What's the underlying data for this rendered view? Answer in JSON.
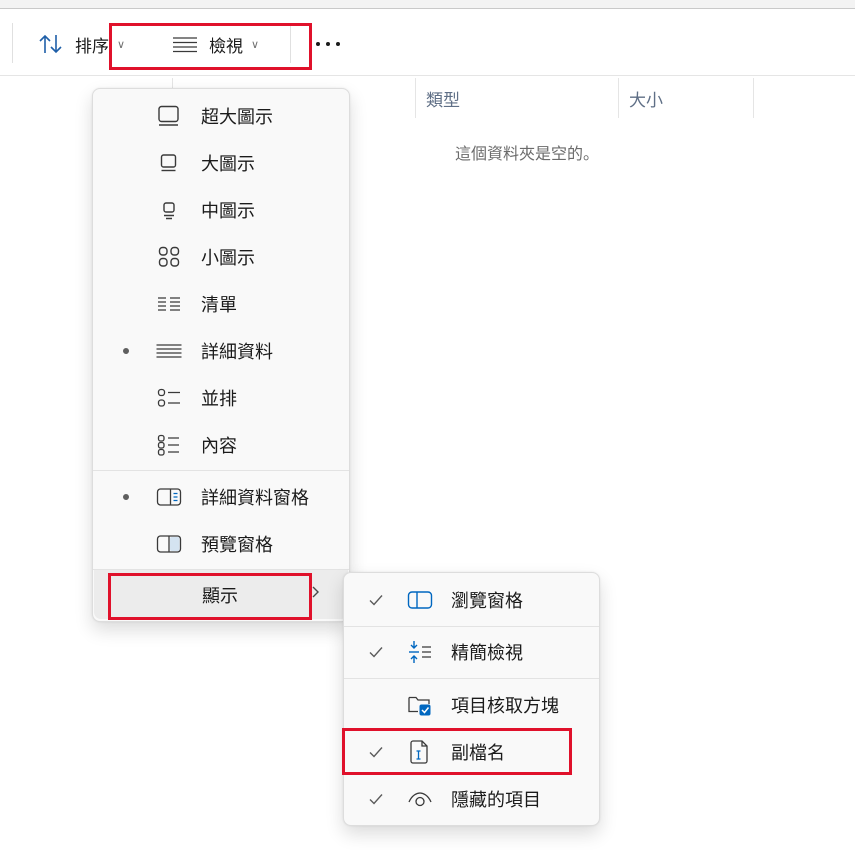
{
  "toolbar": {
    "sort_label": "排序",
    "view_label": "檢視"
  },
  "columns": {
    "type": "類型",
    "size": "大小"
  },
  "empty_message": "這個資料夾是空的。",
  "view_menu": {
    "items": [
      {
        "label": "超大圖示",
        "icon": "extra-large-icons-icon",
        "selected": false
      },
      {
        "label": "大圖示",
        "icon": "large-icons-icon",
        "selected": false
      },
      {
        "label": "中圖示",
        "icon": "medium-icons-icon",
        "selected": false
      },
      {
        "label": "小圖示",
        "icon": "small-icons-icon",
        "selected": false
      },
      {
        "label": "清單",
        "icon": "list-icon",
        "selected": false
      },
      {
        "label": "詳細資料",
        "icon": "details-icon",
        "selected": true
      },
      {
        "label": "並排",
        "icon": "tiles-icon",
        "selected": false
      },
      {
        "label": "內容",
        "icon": "content-icon",
        "selected": false
      }
    ],
    "pane_items": [
      {
        "label": "詳細資料窗格",
        "icon": "details-pane-icon",
        "selected": true
      },
      {
        "label": "預覽窗格",
        "icon": "preview-pane-icon",
        "selected": false
      }
    ],
    "show_label": "顯示"
  },
  "show_submenu": {
    "items": [
      {
        "label": "瀏覽窗格",
        "icon": "navigation-pane-icon",
        "checked": true
      },
      {
        "label": "精簡檢視",
        "icon": "compact-view-icon",
        "checked": true
      },
      {
        "label": "項目核取方塊",
        "icon": "item-checkboxes-icon",
        "checked": false
      },
      {
        "label": "副檔名",
        "icon": "file-extensions-icon",
        "checked": true
      },
      {
        "label": "隱藏的項目",
        "icon": "hidden-items-icon",
        "checked": true
      }
    ]
  },
  "colors": {
    "highlight_box": "#e0112b",
    "accent": "#0067c0"
  }
}
